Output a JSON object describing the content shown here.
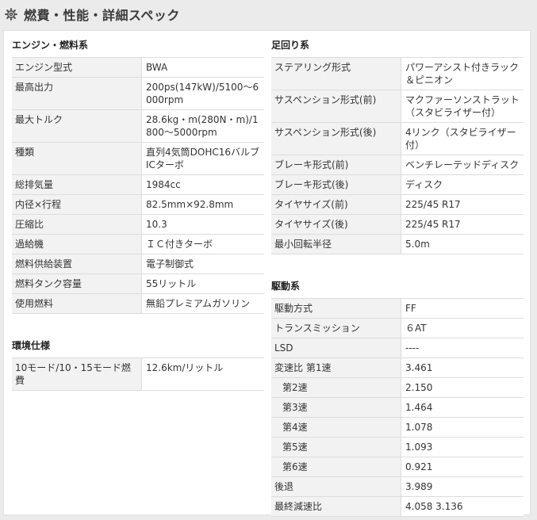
{
  "header": {
    "title": "燃費・性能・詳細スペック",
    "icon": "gear-icon"
  },
  "engine": {
    "title": "エンジン・燃料系",
    "rows": [
      {
        "k": "エンジン型式",
        "v": "BWA"
      },
      {
        "k": "最高出力",
        "v": "200ps(147kW)/5100〜6000rpm"
      },
      {
        "k": "最大トルク",
        "v": "28.6kg・m(280N・m)/1800〜5000rpm"
      },
      {
        "k": "種類",
        "v": "直列4気筒DOHC16バルブICターボ"
      },
      {
        "k": "総排気量",
        "v": "1984cc"
      },
      {
        "k": "内径×行程",
        "v": "82.5mm×92.8mm"
      },
      {
        "k": "圧縮比",
        "v": "10.3"
      },
      {
        "k": "過給機",
        "v": "ＩＣ付きターボ"
      },
      {
        "k": "燃料供給装置",
        "v": "電子制御式"
      },
      {
        "k": "燃料タンク容量",
        "v": "55リットル"
      },
      {
        "k": "使用燃料",
        "v": "無鉛プレミアムガソリン"
      }
    ]
  },
  "env": {
    "title": "環境仕様",
    "rows": [
      {
        "k": "10モード/10・15モード燃費",
        "v": "12.6km/リットル"
      }
    ]
  },
  "suspension": {
    "title": "足回り系",
    "rows": [
      {
        "k": "ステアリング形式",
        "v": "パワーアシスト付きラック＆ピニオン"
      },
      {
        "k": "サスペンション形式(前)",
        "v": "マクファーソンストラット（スタビライザー付）"
      },
      {
        "k": "サスペンション形式(後)",
        "v": "4リンク（スタビライザー付）"
      },
      {
        "k": "ブレーキ形式(前)",
        "v": "ベンチレーテッドディスク"
      },
      {
        "k": "ブレーキ形式(後)",
        "v": "ディスク"
      },
      {
        "k": "タイヤサイズ(前)",
        "v": "225/45 R17"
      },
      {
        "k": "タイヤサイズ(後)",
        "v": "225/45 R17"
      },
      {
        "k": "最小回転半径",
        "v": "5.0m"
      }
    ]
  },
  "drive": {
    "title": "駆動系",
    "rows": [
      {
        "k": "駆動方式",
        "v": "FF"
      },
      {
        "k": "トランスミッション",
        "v": "６AT"
      },
      {
        "k": "LSD",
        "v": "----"
      },
      {
        "k": "変速比 第1速",
        "v": "3.461"
      },
      {
        "k": "第2速",
        "v": "2.150"
      },
      {
        "k": "第3速",
        "v": "1.464"
      },
      {
        "k": "第4速",
        "v": "1.078"
      },
      {
        "k": "第5速",
        "v": "1.093"
      },
      {
        "k": "第6速",
        "v": "0.921"
      },
      {
        "k": "後退",
        "v": "3.989"
      },
      {
        "k": "最終減速比",
        "v": "4.058 3.136"
      }
    ]
  }
}
